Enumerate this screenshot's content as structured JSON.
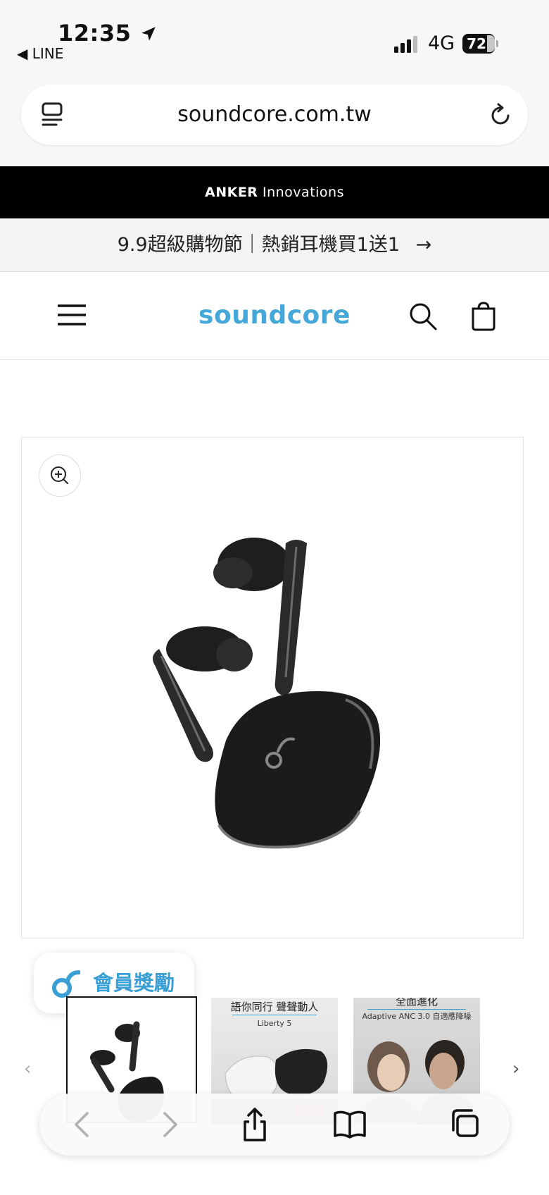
{
  "status_bar": {
    "time": "12:35",
    "back_app": "◀ LINE",
    "network": "4G",
    "battery": "72"
  },
  "browser": {
    "url": "soundcore.com.tw"
  },
  "banner": {
    "brand_bold": "ANKER",
    "brand_rest": " Innovations"
  },
  "promo": {
    "text": "9.9超級購物節｜熱銷耳機買1送1",
    "arrow": "→"
  },
  "header": {
    "logo": "soundcore"
  },
  "rewards": {
    "label": "會員獎勵"
  },
  "thumbnails": [
    {
      "title": "",
      "sub": ""
    },
    {
      "title": "語你同行 聲聲動人",
      "sub": "Liberty 5"
    },
    {
      "title": "全面進化",
      "sub": "Adaptive ANC 3.0 自適應降噪"
    }
  ],
  "colors": {
    "brand_blue": "#45a8d8",
    "banner_bg": "#000000"
  }
}
